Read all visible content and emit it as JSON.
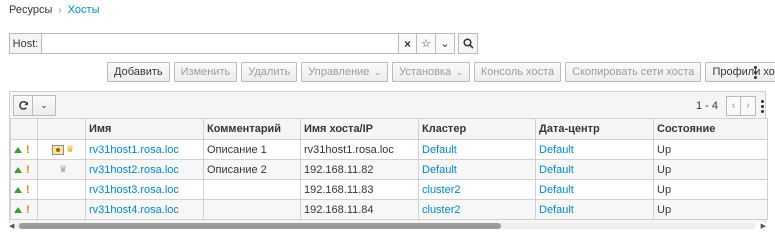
{
  "breadcrumb": {
    "parent": "Ресурсы",
    "separator": "›",
    "current": "Хосты"
  },
  "search": {
    "label": "Host:",
    "value": "",
    "clear_icon": "×",
    "bookmark_icon": "☆",
    "dropdown_icon": "⌄",
    "search_icon": "⚲"
  },
  "toolbar": {
    "add": "Добавить",
    "edit": "Изменить",
    "remove": "Удалить",
    "management": "Управление",
    "installation": "Установка",
    "console": "Консоль хоста",
    "copy_networks": "Скопировать сети хоста",
    "profiles": "Профили хостов",
    "caret": "⌄"
  },
  "pager": {
    "range": "1 - 4",
    "prev": "‹",
    "next": "›"
  },
  "table": {
    "headers": {
      "name": "Имя",
      "comment": "Комментарий",
      "host_ip": "Имя хоста/IP",
      "cluster": "Кластер",
      "datacenter": "Дата-центр",
      "status": "Состояние"
    },
    "rows": [
      {
        "name": "rv31host1.rosa.loc",
        "comment": "Описание 1",
        "host_ip": "rv31host1.rosa.loc",
        "cluster": "Default",
        "datacenter": "Default",
        "status": "Up"
      },
      {
        "name": "rv31host2.rosa.loc",
        "comment": "Описание 2",
        "host_ip": "192.168.11.82",
        "cluster": "Default",
        "datacenter": "Default",
        "status": "Up"
      },
      {
        "name": "rv31host3.rosa.loc",
        "comment": "",
        "host_ip": "192.168.11.83",
        "cluster": "cluster2",
        "datacenter": "Default",
        "status": "Up"
      },
      {
        "name": "rv31host4.rosa.loc",
        "comment": "",
        "host_ip": "192.168.11.84",
        "cluster": "cluster2",
        "datacenter": "Default",
        "status": "Up"
      }
    ]
  },
  "colors": {
    "link": "#0088ce",
    "status_up": "#3f9c35",
    "warning": "#ec7a08",
    "crown_gold": "#f0ab00"
  },
  "icons": {
    "crown": "♛",
    "exclamation": "!"
  }
}
